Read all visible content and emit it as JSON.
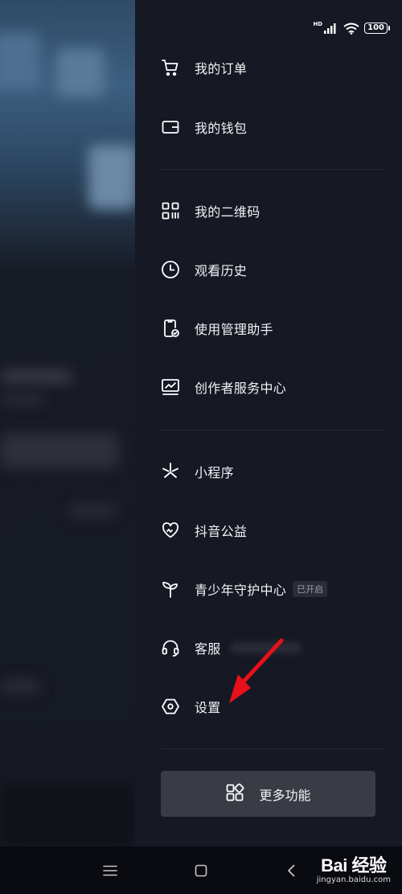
{
  "status_bar": {
    "signal": "HD",
    "battery": "100"
  },
  "menu": {
    "orders": "我的订单",
    "wallet": "我的钱包",
    "qrcode": "我的二维码",
    "history": "观看历史",
    "usage_manager": "使用管理助手",
    "creator_center": "创作者服务中心",
    "mini_programs": "小程序",
    "charity": "抖音公益",
    "youth_mode": "青少年守护中心",
    "youth_mode_badge": "已开启",
    "customer_service": "客服",
    "settings": "设置"
  },
  "more_button": {
    "label": "更多功能"
  },
  "watermark": {
    "logo": "Bai 经验",
    "url": "jingyan.baidu.com"
  },
  "colors": {
    "drawer_bg": "#161823",
    "annotation_arrow": "#e8101a"
  }
}
